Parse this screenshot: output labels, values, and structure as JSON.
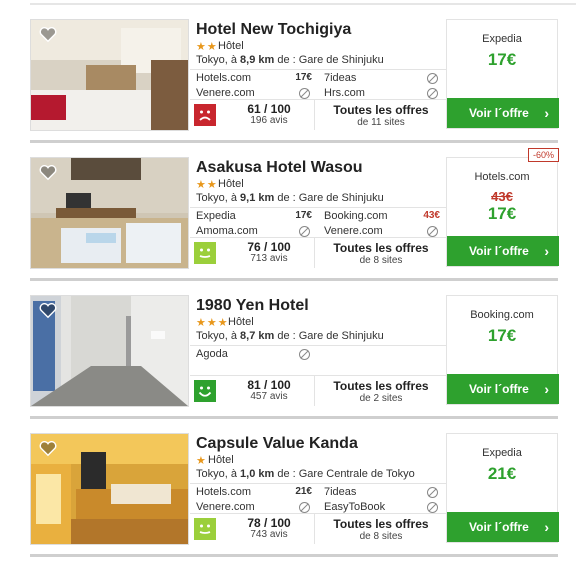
{
  "hotels": [
    {
      "name": "Hotel New Tochigiya",
      "stars": "★★",
      "type": "Hôtel",
      "loc_pre": "Tokyo, à ",
      "loc_dist": "8,9 km",
      "loc_post": " de : Gare de Shinjuku",
      "prices": [
        {
          "name": "Hotels.com",
          "value": "17€"
        },
        {
          "name": "7ideas",
          "value": ""
        },
        {
          "name": "Venere.com",
          "value": ""
        },
        {
          "name": "Hrs.com",
          "value": ""
        }
      ],
      "score": "61 / 100",
      "reviews": "196 avis",
      "face": "sad",
      "face_color": "#c8262e",
      "offers_title": "Toutes les offres",
      "offers_sub": "de 11 sites",
      "provider": "Expedia",
      "old_price": "",
      "price": "17€",
      "discount": "",
      "cta": "Voir l´offre"
    },
    {
      "name": "Asakusa Hotel Wasou",
      "stars": "★★",
      "type": "Hôtel",
      "loc_pre": "Tokyo, à ",
      "loc_dist": "9,1 km",
      "loc_post": " de : Gare de Shinjuku",
      "prices": [
        {
          "name": "Expedia",
          "value": "17€"
        },
        {
          "name": "Booking.com",
          "value": "43€"
        },
        {
          "name": "Amoma.com",
          "value": ""
        },
        {
          "name": "Venere.com",
          "value": ""
        }
      ],
      "score": "76 / 100",
      "reviews": "713 avis",
      "face": "neutral",
      "face_color": "#9bcf3b",
      "offers_title": "Toutes les offres",
      "offers_sub": "de 8 sites",
      "provider": "Hotels.com",
      "old_price": "43€",
      "price": "17€",
      "discount": "-60%",
      "cta": "Voir l´offre"
    },
    {
      "name": "1980 Yen Hotel",
      "stars": "★★★",
      "type": "Hôtel",
      "loc_pre": "Tokyo, à ",
      "loc_dist": "8,7 km",
      "loc_post": " de : Gare de Shinjuku",
      "prices": [
        {
          "name": "Agoda",
          "value": ""
        }
      ],
      "score": "81 / 100",
      "reviews": "457 avis",
      "face": "happy",
      "face_color": "#2ea12e",
      "offers_title": "Toutes les offres",
      "offers_sub": "de 2 sites",
      "provider": "Booking.com",
      "old_price": "",
      "price": "17€",
      "discount": "",
      "cta": "Voir l´offre"
    },
    {
      "name": "Capsule Value Kanda",
      "stars": "★",
      "type": "Hôtel",
      "loc_pre": "Tokyo, à ",
      "loc_dist": "1,0 km",
      "loc_post": " de : Gare Centrale de Tokyo",
      "prices": [
        {
          "name": "Hotels.com",
          "value": "21€"
        },
        {
          "name": "7ideas",
          "value": ""
        },
        {
          "name": "Venere.com",
          "value": ""
        },
        {
          "name": "EasyToBook",
          "value": ""
        }
      ],
      "score": "78 / 100",
      "reviews": "743 avis",
      "face": "neutral",
      "face_color": "#9bcf3b",
      "offers_title": "Toutes les offres",
      "offers_sub": "de 8 sites",
      "provider": "Expedia",
      "old_price": "",
      "price": "21€",
      "discount": "",
      "cta": "Voir l´offre"
    }
  ]
}
